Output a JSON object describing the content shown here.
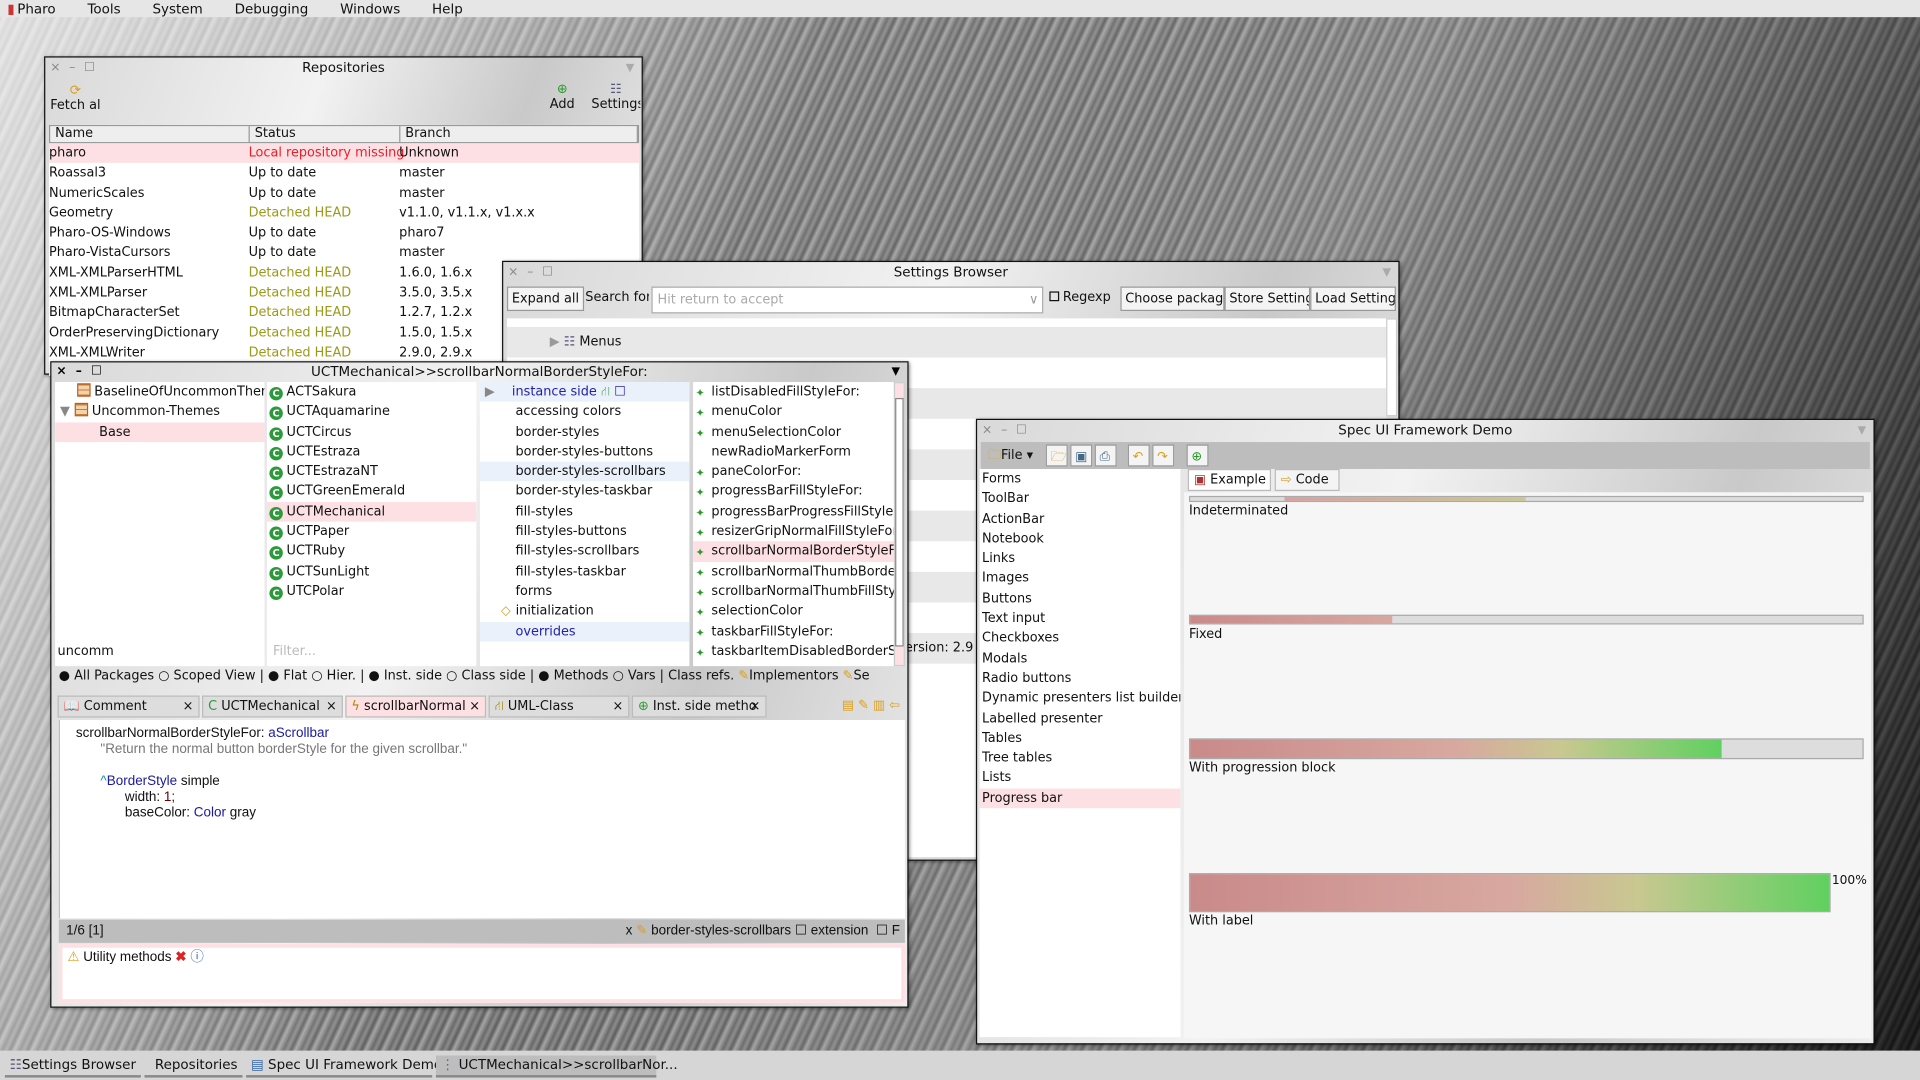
{
  "menubar": {
    "items": [
      "Pharo",
      "Tools",
      "System",
      "Debugging",
      "Windows",
      "Help"
    ]
  },
  "repositories": {
    "title": "Repositories",
    "fetch_label": "Fetch al",
    "add_label": "Add",
    "settings_label": "Settings",
    "columns": [
      "Name",
      "Status",
      "Branch"
    ],
    "rows": [
      {
        "name": "pharo",
        "status": "Local repository missing",
        "branch": "Unknown",
        "state": "missing"
      },
      {
        "name": "Roassal3",
        "status": "Up to date",
        "branch": "master",
        "state": "ok"
      },
      {
        "name": "NumericScales",
        "status": "Up to date",
        "branch": "master",
        "state": "ok"
      },
      {
        "name": "Geometry",
        "status": "Detached HEAD",
        "branch": "v1.1.0, v1.1.x, v1.x.x",
        "state": "detached"
      },
      {
        "name": "Pharo-OS-Windows",
        "status": "Up to date",
        "branch": "pharo7",
        "state": "ok"
      },
      {
        "name": "Pharo-VistaCursors",
        "status": "Up to date",
        "branch": "master",
        "state": "ok"
      },
      {
        "name": "XML-XMLParserHTML",
        "status": "Detached HEAD",
        "branch": "1.6.0, 1.6.x",
        "state": "detached"
      },
      {
        "name": "XML-XMLParser",
        "status": "Detached HEAD",
        "branch": "3.5.0, 3.5.x",
        "state": "detached"
      },
      {
        "name": "BitmapCharacterSet",
        "status": "Detached HEAD",
        "branch": "1.2.7, 1.2.x",
        "state": "detached"
      },
      {
        "name": "OrderPreservingDictionary",
        "status": "Detached HEAD",
        "branch": "1.5.0, 1.5.x",
        "state": "detached"
      },
      {
        "name": "XML-XMLWriter",
        "status": "Detached HEAD",
        "branch": "2.9.0, 2.9.x",
        "state": "detached"
      }
    ]
  },
  "settings": {
    "title": "Settings Browser",
    "expand_all": "Expand all",
    "search_label": "Search for",
    "search_placeholder": "Hit return to accept",
    "regexp_label": "Regexp",
    "choose_packages": "Choose packages",
    "store_settings": "Store Settings",
    "load_settings": "Load Settings",
    "tree": [
      "Menus"
    ],
    "partial_text": "ersion: 2.9"
  },
  "browser": {
    "title": "UCTMechanical>>scrollbarNormalBorderStyleFor:",
    "packages": [
      {
        "label": "BaselineOfUncommonThemes",
        "indent": 1
      },
      {
        "label": "Uncommon-Themes",
        "indent": 0,
        "expanded": true
      },
      {
        "label": "Base",
        "indent": 2,
        "selected": true
      }
    ],
    "package_filter": "uncomm",
    "classes": [
      "ACTSakura",
      "UCTAquamarine",
      "UCTCircus",
      "UCTEstraza",
      "UCTEstrazaNT",
      "UCTGreenEmerald",
      "UCTMechanical",
      "UCTPaper",
      "UCTRuby",
      "UCTSunLight",
      "UTCPolar"
    ],
    "selected_class": "UCTMechanical",
    "class_filter_placeholder": "Filter...",
    "protocols": [
      "instance side",
      "accessing colors",
      "border-styles",
      "border-styles-buttons",
      "border-styles-scrollbars",
      "border-styles-taskbar",
      "fill-styles",
      "fill-styles-buttons",
      "fill-styles-scrollbars",
      "fill-styles-taskbar",
      "forms",
      "initialization",
      "overrides"
    ],
    "methods": [
      "listDisabledFillStyleFor:",
      "menuColor",
      "menuSelectionColor",
      "newRadioMarkerForm",
      "paneColorFor:",
      "progressBarFillStyleFor:",
      "progressBarProgressFillStyleFor:",
      "resizerGripNormalFillStyleFor:",
      "scrollbarNormalBorderStyleFor:",
      "scrollbarNormalThumbBorderStyleFor:",
      "scrollbarNormalThumbFillStyleFor:",
      "selectionColor",
      "taskbarFillStyleFor:",
      "taskbarItemDisabledBorderStyleFor:"
    ],
    "selected_method": "scrollbarNormalBorderStyleFor:",
    "scope_bar": {
      "all_packages": "All Packages",
      "scoped_view": "Scoped View",
      "flat": "Flat",
      "hier": "Hier.",
      "inst_side": "Inst. side",
      "class_side": "Class side",
      "methods": "Methods",
      "vars": "Vars",
      "class_refs": "Class refs.",
      "implementors": "Implementors",
      "senders": "Se"
    },
    "tabs": [
      "Comment",
      "UCTMechanical",
      "scrollbarNormal",
      "UML-Class",
      "Inst. side metho"
    ],
    "code": {
      "selector": "scrollbarNormalBorderStyleFor:",
      "arg": "aScrollbar",
      "comment": "\"Return the normal button borderStyle for the given scrollbar.\"",
      "caret": "^",
      "class1": "BorderStyle",
      "msg1": "simple",
      "kw2": "width:",
      "val2": "1;",
      "kw3": "baseColor:",
      "class3": "Color",
      "msg3": "gray"
    },
    "status": {
      "position": "1/6 [1]",
      "close": "x",
      "protocol": "border-styles-scrollbars",
      "extension": "extension",
      "f": "F"
    },
    "critique": "Utility methods"
  },
  "spec": {
    "title": "Spec UI Framework Demo",
    "file_menu": "File",
    "list": [
      "Forms",
      "ToolBar",
      "ActionBar",
      "Notebook",
      "Links",
      "Images",
      "Buttons",
      "Text input",
      "Checkboxes",
      "Modals",
      "Radio buttons",
      "Dynamic presenters list builder",
      "Labelled presenter",
      "Tables",
      "Tree tables",
      "Lists",
      "Progress bar"
    ],
    "selected": "Progress bar",
    "tabs": [
      "Example",
      "Code"
    ],
    "progress": {
      "indeterminate_label": "Indeterminated",
      "fixed_label": "Fixed",
      "fixed_value": 0.3,
      "block_label": "With progression block",
      "block_value": 0.79,
      "labelled_label": "With label",
      "labelled_value": 1.0,
      "labelled_text": "100%"
    }
  },
  "taskbar": [
    "Settings Browser",
    "Repositories",
    "Spec UI Framework Demo",
    "UCTMechanical>>scrollbarNor..."
  ]
}
